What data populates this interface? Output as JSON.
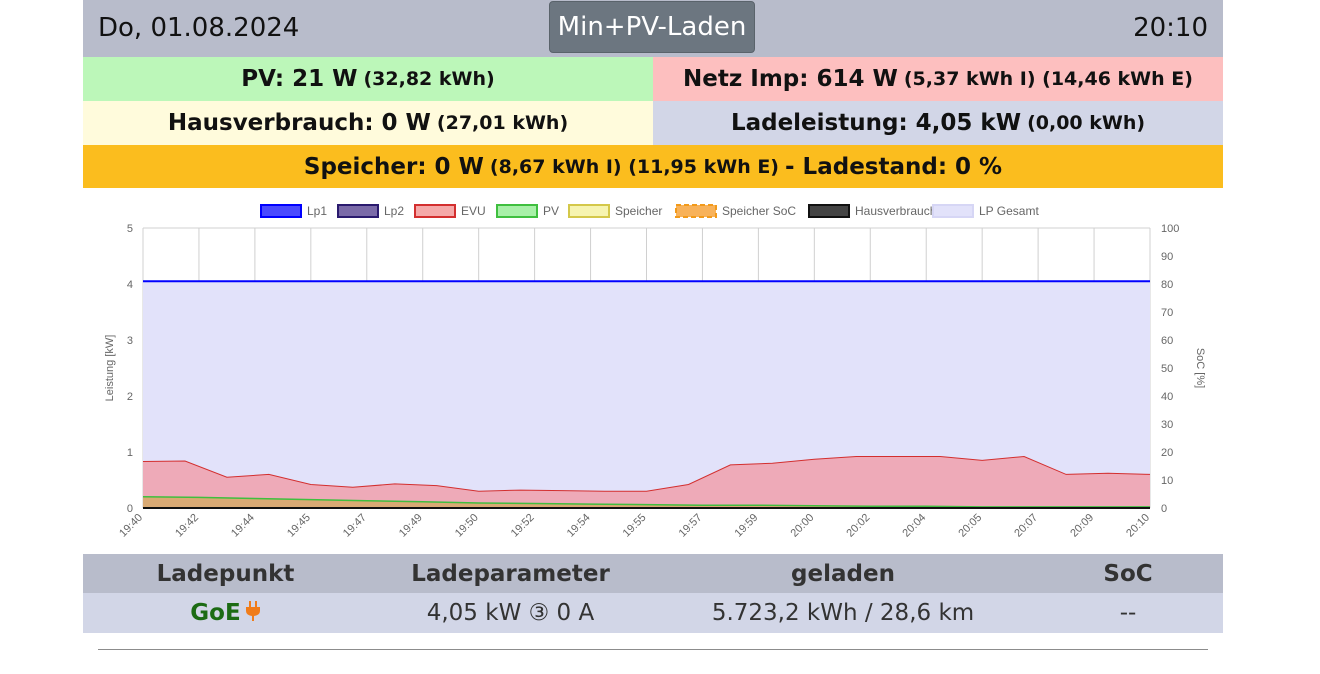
{
  "header": {
    "date": "Do, 01.08.2024",
    "mode_label": "Min+PV-Laden",
    "time": "20:10"
  },
  "summary": {
    "pv": {
      "main": "PV: 21 W",
      "detail": "(32,82 kWh)"
    },
    "netz": {
      "main": "Netz Imp: 614 W",
      "detail": "(5,37 kWh I) (14,46 kWh E)"
    },
    "haus": {
      "main": "Hausverbrauch: 0 W",
      "detail": "(27,01 kWh)"
    },
    "lade": {
      "main": "Ladeleistung: 4,05 kW",
      "detail": "(0,00 kWh)"
    },
    "speicher": {
      "main": "Speicher: 0 W",
      "detail": "(8,67 kWh I) (11,95 kWh E)",
      "tail": "- Ladestand: 0 %"
    }
  },
  "chart_data": {
    "type": "area",
    "ylabel_left": "Leistung [kW]",
    "ylabel_right": "SoC [%]",
    "ylim_left": [
      0,
      5
    ],
    "ylim_right": [
      0,
      100
    ],
    "yticks_left": [
      "0",
      "1",
      "2",
      "3",
      "4",
      "5"
    ],
    "yticks_right": [
      "0",
      "10",
      "20",
      "30",
      "40",
      "50",
      "60",
      "70",
      "80",
      "90",
      "100"
    ],
    "x_ticks": [
      "19:40",
      "19:42",
      "19:44",
      "19:45",
      "19:47",
      "19:49",
      "19:50",
      "19:52",
      "19:54",
      "19:55",
      "19:57",
      "19:59",
      "20:00",
      "20:02",
      "20:04",
      "20:05",
      "20:07",
      "20:09",
      "20:10"
    ],
    "grid": true,
    "legend_position": "top",
    "legend": [
      {
        "name": "Lp1",
        "color": "#0000ff",
        "fill": "#4a4aff"
      },
      {
        "name": "Lp2",
        "color": "#2a1a6e",
        "fill": "#7a6aa8"
      },
      {
        "name": "EVU",
        "color": "#d32f2f",
        "fill": "#f5a9a9"
      },
      {
        "name": "PV",
        "color": "#3fbf3f",
        "fill": "#a8f0a8"
      },
      {
        "name": "Speicher",
        "color": "#d4c84a",
        "fill": "#f6f4b0"
      },
      {
        "name": "Speicher SoC",
        "color": "#f29a1a",
        "fill": "#f8b25a"
      },
      {
        "name": "Hausverbrauch",
        "color": "#111111",
        "fill": "#444444"
      },
      {
        "name": "LP Gesamt",
        "color": "#d6d6f5",
        "fill": "#e2e2fa"
      }
    ],
    "series": [
      {
        "name": "Lp1",
        "values": [
          4.05,
          4.05,
          4.05,
          4.05,
          4.05,
          4.05,
          4.05,
          4.05,
          4.05,
          4.05,
          4.05,
          4.05,
          4.05,
          4.05,
          4.05,
          4.05,
          4.05,
          4.05,
          4.05
        ]
      },
      {
        "name": "LP Gesamt",
        "values": [
          4.05,
          4.05,
          4.05,
          4.05,
          4.05,
          4.05,
          4.05,
          4.05,
          4.05,
          4.05,
          4.05,
          4.05,
          4.05,
          4.05,
          4.05,
          4.05,
          4.05,
          4.05,
          4.05
        ]
      },
      {
        "name": "EVU",
        "values": [
          0.83,
          0.84,
          0.55,
          0.6,
          0.42,
          0.37,
          0.43,
          0.4,
          0.3,
          0.32,
          0.31,
          0.3,
          0.3,
          0.42,
          0.77,
          0.8,
          0.87,
          0.92,
          0.92,
          0.92,
          0.85,
          0.92,
          0.6,
          0.62,
          0.6
        ]
      },
      {
        "name": "PV",
        "values": [
          0.2,
          0.19,
          0.17,
          0.15,
          0.13,
          0.11,
          0.09,
          0.08,
          0.07,
          0.06,
          0.05,
          0.05,
          0.04,
          0.03,
          0.03,
          0.02,
          0.02,
          0.02,
          0.02
        ]
      },
      {
        "name": "Hausverbrauch",
        "values": [
          0,
          0,
          0,
          0,
          0,
          0,
          0,
          0,
          0,
          0,
          0,
          0,
          0,
          0,
          0,
          0,
          0,
          0,
          0
        ]
      }
    ]
  },
  "table": {
    "headers": [
      "Ladepunkt",
      "Ladeparameter",
      "geladen",
      "SoC"
    ],
    "row": {
      "name": "GoE",
      "params": "4,05 kW ③ 0 A",
      "charged": "5.723,2 kWh / 28,6 km",
      "soc": "--"
    }
  }
}
